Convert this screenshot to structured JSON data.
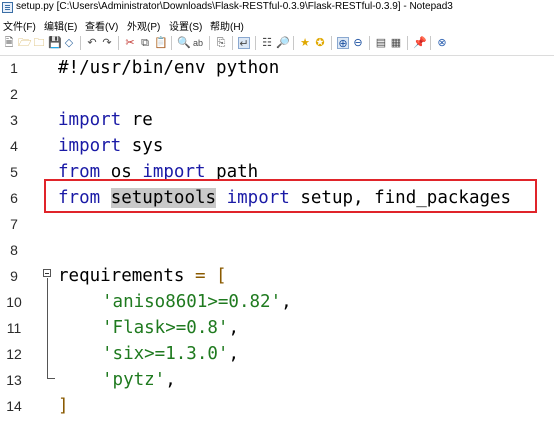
{
  "window": {
    "title": "setup.py [C:\\Users\\Administrator\\Downloads\\Flask-RESTful-0.3.9\\Flask-RESTful-0.3.9] - Notepad3"
  },
  "menu": [
    "文件(F)",
    "编辑(E)",
    "查看(V)",
    "外观(P)",
    "设置(S)",
    "帮助(H)"
  ],
  "toolbar": {
    "icons": [
      "new-file-icon",
      "open-folder-icon",
      "browse-icon",
      "save-icon",
      "save-as-icon",
      "undo-icon",
      "redo-icon",
      "cut-icon",
      "copy-icon",
      "paste-icon",
      "find-icon",
      "replace-icon",
      "goto-icon",
      "word-wrap-icon",
      "zoom-icon",
      "favorites-icon",
      "add-favorite-icon",
      "zoom-in-icon",
      "zoom-out-icon",
      "schemes-icon",
      "customize-icon",
      "pin-icon",
      "exit-icon"
    ]
  },
  "editor": {
    "lines": [
      {
        "n": "1",
        "text": "#!/usr/bin/env python"
      },
      {
        "n": "2",
        "text": ""
      },
      {
        "n": "3",
        "kw": "import",
        "rest": " re"
      },
      {
        "n": "4",
        "kw": "import",
        "rest": " sys"
      },
      {
        "n": "5",
        "kw": "from",
        "mid": " os ",
        "kw2": "import",
        "rest": " path"
      },
      {
        "n": "6",
        "kw": "from",
        "sel": "setuptools",
        "kw2": "import",
        "rest": " setup, find_packages"
      },
      {
        "n": "7",
        "text": ""
      },
      {
        "n": "8",
        "text": ""
      },
      {
        "n": "9",
        "ident": "requirements",
        "op": " = ["
      },
      {
        "n": "10",
        "str": "'aniso8601>=0.82'",
        "rest": ","
      },
      {
        "n": "11",
        "str": "'Flask>=0.8'",
        "rest": ","
      },
      {
        "n": "12",
        "str": "'six>=1.3.0'",
        "rest": ","
      },
      {
        "n": "13",
        "str": "'pytz'",
        "rest": ","
      },
      {
        "n": "14",
        "op": "]"
      }
    ]
  }
}
